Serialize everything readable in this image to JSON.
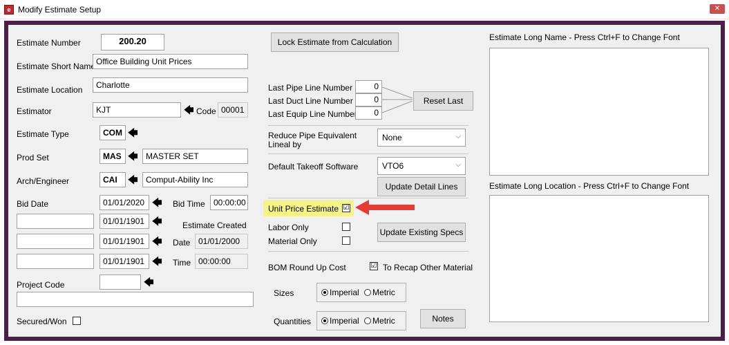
{
  "window": {
    "title": "Modify Estimate Setup",
    "close_symbol": "✕"
  },
  "labels": {
    "estimate_number": "Estimate Number",
    "estimate_short_name": "Estimate Short Name",
    "estimate_location": "Estimate Location",
    "estimator": "Estimator",
    "code": "Code",
    "estimate_type": "Estimate Type",
    "prod_set": "Prod Set",
    "arch_engineer": "Arch/Engineer",
    "bid_date": "Bid Date",
    "bid_time": "Bid Time",
    "estimate_created": "Estimate Created",
    "date": "Date",
    "time": "Time",
    "project_code": "Project Code",
    "secured_won": "Secured/Won",
    "last_pipe_line": "Last Pipe Line Number",
    "last_duct_line": "Last Duct Line Number",
    "last_equip_line": "Last Equip Line Number",
    "reduce_pipe": "Reduce Pipe Equivalent",
    "lineal_by": "Lineal by",
    "default_takeoff": "Default Takeoff Software",
    "unit_price_estimate": "Unit Price Estimate",
    "labor_only": "Labor Only",
    "material_only": "Material Only",
    "bom_round_up": "BOM Round Up Cost",
    "to_recap": "To Recap Other Material",
    "sizes": "Sizes",
    "quantities": "Quantities",
    "imperial": "Imperial",
    "metric": "Metric",
    "long_name": "Estimate Long Name - Press Ctrl+F to Change Font",
    "long_location": "Estimate Long Location - Press Ctrl+F to Change Font"
  },
  "values": {
    "estimate_number": "200.20",
    "short_name": "Office Building Unit Prices",
    "location": "Charlotte",
    "estimator": "KJT",
    "estimator_code": "00001",
    "estimate_type": "COM",
    "prod_set_code": "MAS",
    "prod_set_name": "MASTER SET",
    "arch_code": "CAI",
    "arch_name": "Comput-Ability Inc",
    "bid_date": "01/01/2020",
    "bid_time": "00:00:00",
    "date2": "01/01/1901",
    "date3": "01/01/1901",
    "date4": "01/01/1901",
    "created_date": "01/01/2000",
    "created_time": "00:00:00",
    "last_pipe": "0",
    "last_duct": "0",
    "last_equip": "0",
    "reduce_pipe": "None",
    "takeoff_software": "VTO6",
    "unit_price_checked": "☑",
    "recap_checked": "☑"
  },
  "buttons": {
    "lock_estimate": "Lock Estimate from Calculation",
    "reset_last": "Reset Last",
    "update_detail": "Update Detail Lines",
    "update_specs": "Update Existing Specs",
    "notes": "Notes"
  },
  "icons": {
    "left_arrow": "🡄",
    "caret": "⌵"
  },
  "colors": {
    "frame": "#4a1f4a",
    "highlight": "#f4f489",
    "annotation_arrow": "#e53935"
  }
}
